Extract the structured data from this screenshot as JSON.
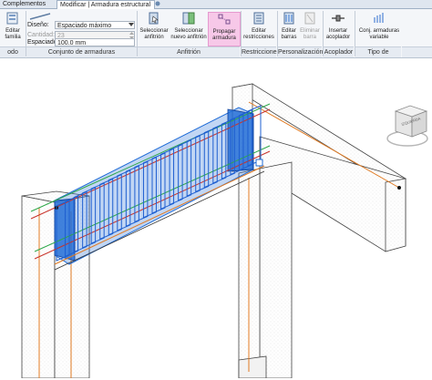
{
  "tabs": {
    "complementos": "Complementos",
    "modificar": "Modificar | Armadura estructural"
  },
  "panel": {
    "diseno_label": "Diseño:",
    "diseno_value": "Espaciado máximo",
    "cantidad_label": "Cantidad:",
    "cantidad_value": "23",
    "espaciado_label": "Espaciado:",
    "espaciado_value": "100.0 mm"
  },
  "buttons": {
    "editar_familia": "Editar familia",
    "seleccionar_anfitrion": "Seleccionar anfitrión",
    "seleccionar_nuevo_anfitrion": "Seleccionar nuevo anfitrión",
    "propagar_armadura": "Propagar armadura",
    "editar_restricciones": "Editar restricciones",
    "editar_barras": "Editar barras",
    "eliminar_barra": "Eliminar barra",
    "insertar_acoplador": "Insertar acoplador",
    "conj_armaduras_variable": "Conj. armaduras variable"
  },
  "groups": {
    "modo": "odo",
    "conjunto": "Conjunto de armaduras",
    "anfitrion": "Anfitrión",
    "restricciones": "Restricciones",
    "personalizacion": "Personalización",
    "acoplador": "Acoplador",
    "tipo_conjunto": "Tipo de conjunto"
  },
  "viewcube": {
    "face": "IZQUIERDA"
  },
  "colors": {
    "selection_blue": "#1f6bd6",
    "stirrup_blue": "#1e5fd0",
    "bar_green": "#2ea84a",
    "bar_red": "#c8322a",
    "bar_orange": "#e07a22",
    "highlight_pink": "#f7c8e8"
  }
}
